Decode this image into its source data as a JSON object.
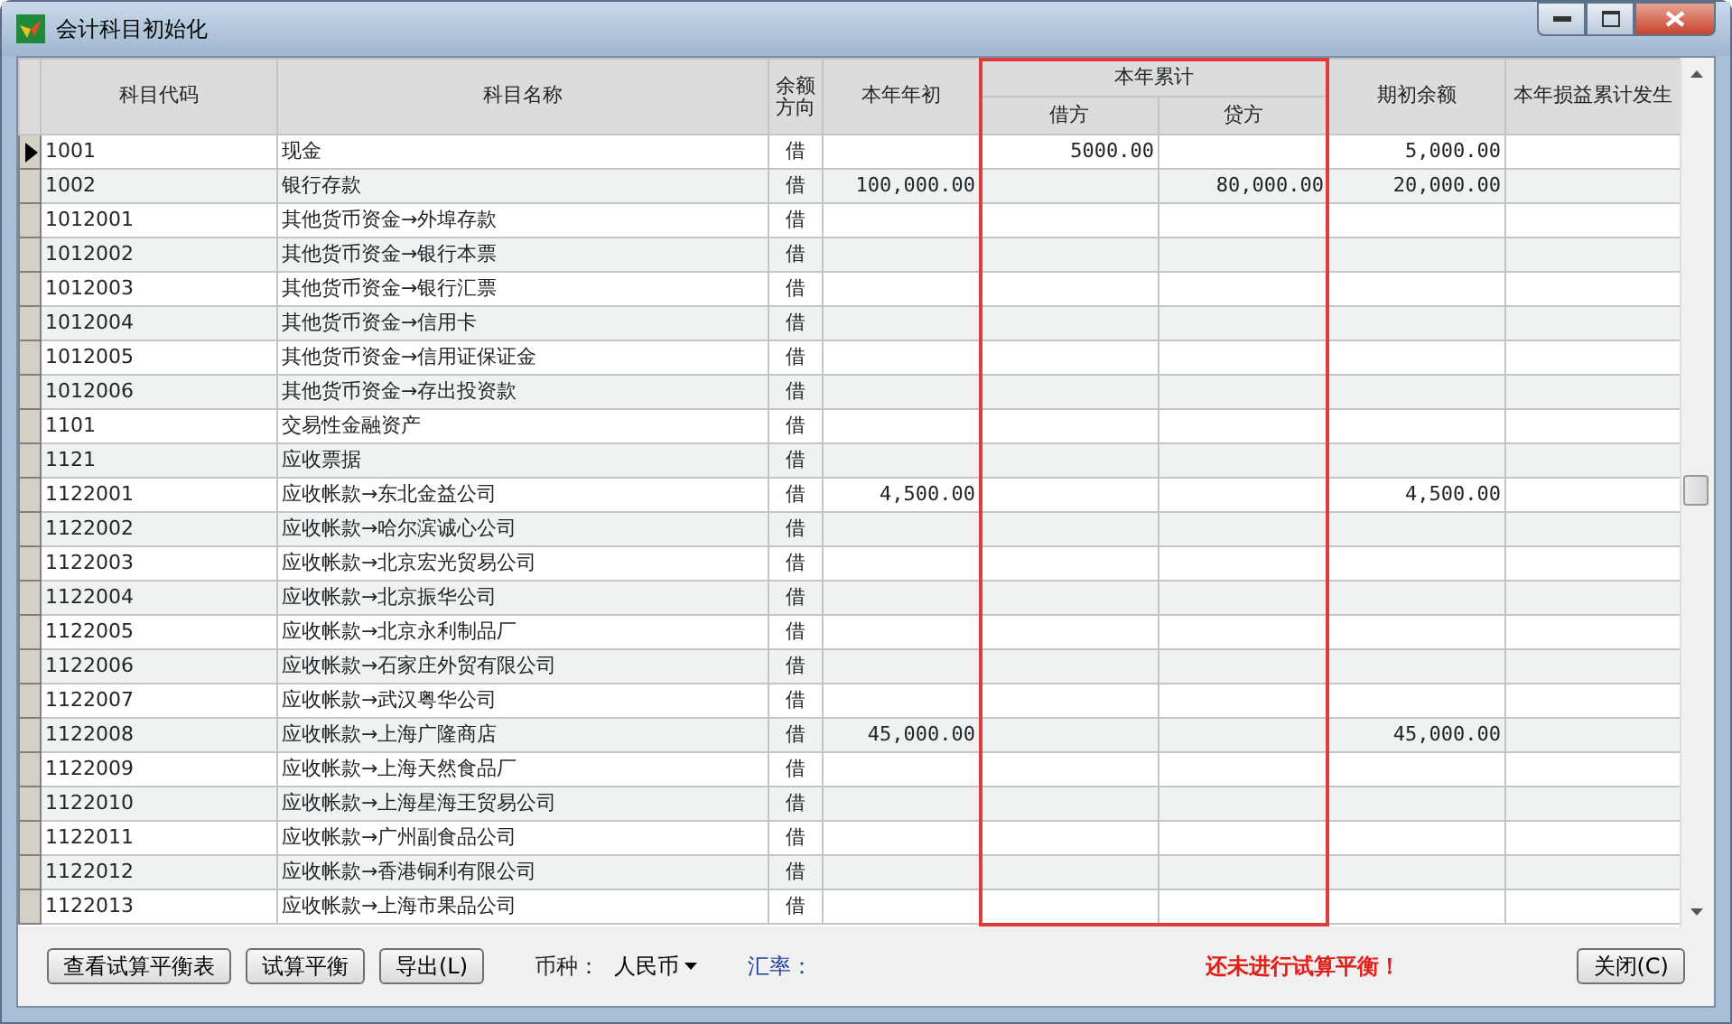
{
  "window": {
    "title": "会计科目初始化"
  },
  "table": {
    "columns": [
      {
        "label": "科目代码"
      },
      {
        "label": "科目名称"
      },
      {
        "label": "余额方向"
      },
      {
        "label": "本年年初"
      },
      {
        "label": "本年累计",
        "children": [
          {
            "label": "借方"
          },
          {
            "label": "贷方"
          }
        ]
      },
      {
        "label": "期初余额"
      },
      {
        "label": "本年损益累计发生"
      }
    ],
    "rows": [
      {
        "selected": true,
        "code": "1001",
        "name": "现金",
        "direction": "借",
        "debit": "5000.00",
        "balance": "5,000.00"
      },
      {
        "selected": false,
        "code": "1002",
        "name": "银行存款",
        "direction": "借",
        "opening": "100,000.00",
        "credit": "80,000.00",
        "balance": "20,000.00"
      },
      {
        "selected": false,
        "code": "1012001",
        "name": "其他货币资金→外埠存款",
        "direction": "借"
      },
      {
        "selected": false,
        "code": "1012002",
        "name": "其他货币资金→银行本票",
        "direction": "借"
      },
      {
        "selected": false,
        "code": "1012003",
        "name": "其他货币资金→银行汇票",
        "direction": "借"
      },
      {
        "selected": false,
        "code": "1012004",
        "name": "其他货币资金→信用卡",
        "direction": "借"
      },
      {
        "selected": false,
        "code": "1012005",
        "name": "其他货币资金→信用证保证金",
        "direction": "借"
      },
      {
        "selected": false,
        "code": "1012006",
        "name": "其他货币资金→存出投资款",
        "direction": "借"
      },
      {
        "selected": false,
        "code": "1101",
        "name": "交易性金融资产",
        "direction": "借"
      },
      {
        "selected": false,
        "code": "1121",
        "name": "应收票据",
        "direction": "借"
      },
      {
        "selected": false,
        "code": "1122001",
        "name": "应收帐款→东北金益公司",
        "direction": "借",
        "opening": "4,500.00",
        "balance": "4,500.00"
      },
      {
        "selected": false,
        "code": "1122002",
        "name": "应收帐款→哈尔滨诚心公司",
        "direction": "借"
      },
      {
        "selected": false,
        "code": "1122003",
        "name": "应收帐款→北京宏光贸易公司",
        "direction": "借"
      },
      {
        "selected": false,
        "code": "1122004",
        "name": "应收帐款→北京振华公司",
        "direction": "借"
      },
      {
        "selected": false,
        "code": "1122005",
        "name": "应收帐款→北京永利制品厂",
        "direction": "借"
      },
      {
        "selected": false,
        "code": "1122006",
        "name": "应收帐款→石家庄外贸有限公司",
        "direction": "借"
      },
      {
        "selected": false,
        "code": "1122007",
        "name": "应收帐款→武汉粤华公司",
        "direction": "借"
      },
      {
        "selected": false,
        "code": "1122008",
        "name": "应收帐款→上海广隆商店",
        "direction": "借",
        "opening": "45,000.00",
        "balance": "45,000.00"
      },
      {
        "selected": false,
        "code": "1122009",
        "name": "应收帐款→上海天然食品厂",
        "direction": "借"
      },
      {
        "selected": false,
        "code": "1122010",
        "name": "应收帐款→上海星海王贸易公司",
        "direction": "借"
      },
      {
        "selected": false,
        "code": "1122011",
        "name": "应收帐款→广州副食品公司",
        "direction": "借"
      },
      {
        "selected": false,
        "code": "1122012",
        "name": "应收帐款→香港铜利有限公司",
        "direction": "借"
      },
      {
        "selected": false,
        "code": "1122013",
        "name": "应收帐款→上海市果品公司",
        "direction": "借"
      }
    ]
  },
  "footer": {
    "buttons": [
      {
        "label": "查看试算平衡表"
      },
      {
        "label": "试算平衡"
      },
      {
        "label": "导出(L)"
      }
    ],
    "currency": {
      "label": "币种：",
      "value": "人民币"
    },
    "rate": {
      "label": "汇率："
    },
    "status": "还未进行试算平衡！",
    "close_button": "关闭(C)"
  }
}
